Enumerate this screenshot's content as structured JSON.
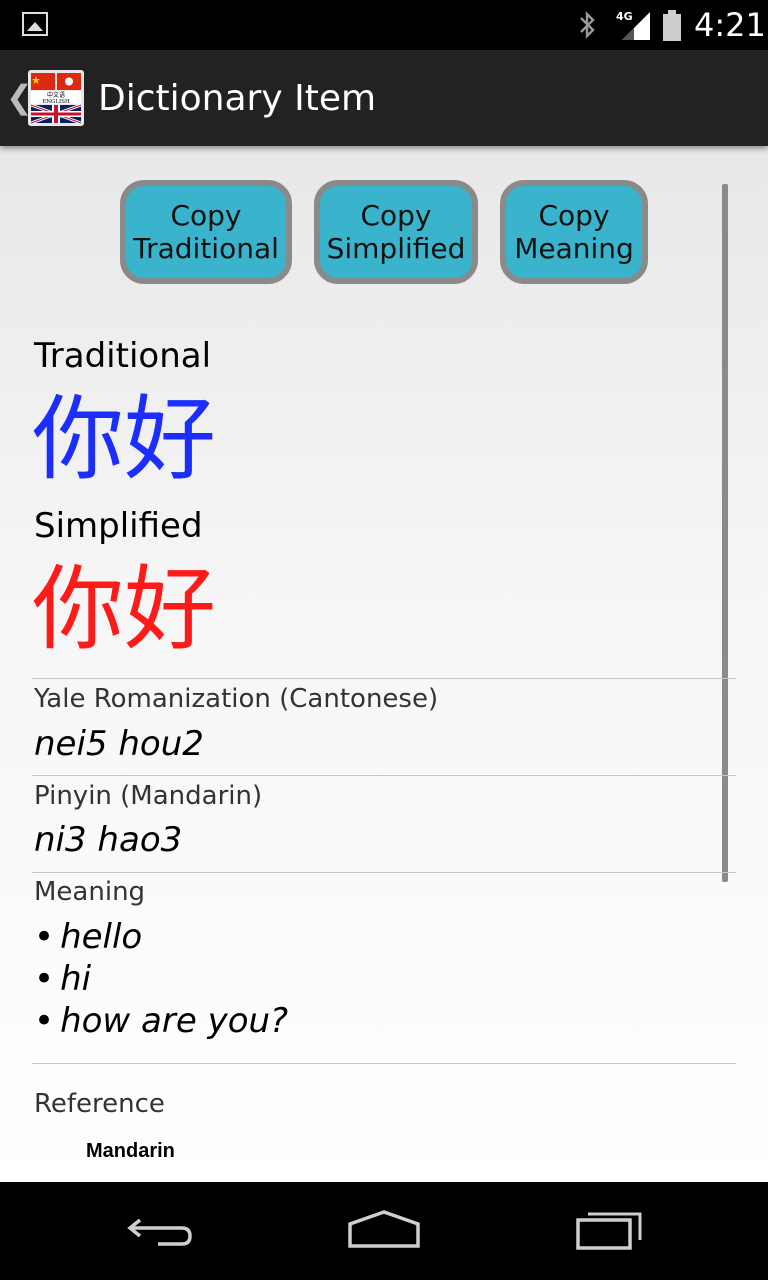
{
  "status_bar": {
    "network_label": "4G",
    "time": "4:21",
    "icons": [
      "image-notification-icon",
      "bluetooth-icon",
      "signal-icon",
      "battery-icon"
    ]
  },
  "action_bar": {
    "title": "Dictionary Item",
    "icons": [
      "back-caret-icon",
      "app-logo-icon"
    ],
    "logo_text": [
      "中文语",
      "ENGLISH"
    ]
  },
  "buttons": {
    "copy_traditional": [
      "Copy",
      "Traditional"
    ],
    "copy_simplified": [
      "Copy",
      "Simplified"
    ],
    "copy_meaning": [
      "Copy",
      "Meaning"
    ]
  },
  "entry": {
    "traditional_label": "Traditional",
    "traditional_value": "你好",
    "simplified_label": "Simplified",
    "simplified_value": "你好",
    "yale_label": "Yale Romanization (Cantonese)",
    "yale_value": "nei5 hou2",
    "pinyin_label": "Pinyin (Mandarin)",
    "pinyin_value": "ni3 hao3",
    "meaning_label": "Meaning",
    "meanings": [
      "hello",
      "hi",
      "how are you?"
    ],
    "bullet": "•",
    "reference_label": "Reference",
    "reference_sub": "Mandarin"
  },
  "colors": {
    "traditional": "#1c2eff",
    "simplified": "#ff1a1a",
    "button_fill": "#3ab4cc",
    "button_border": "#8a8a8a",
    "action_bar": "#222222"
  },
  "nav_bar": {
    "icons": [
      "back-nav-icon",
      "home-nav-icon",
      "recents-nav-icon"
    ]
  }
}
